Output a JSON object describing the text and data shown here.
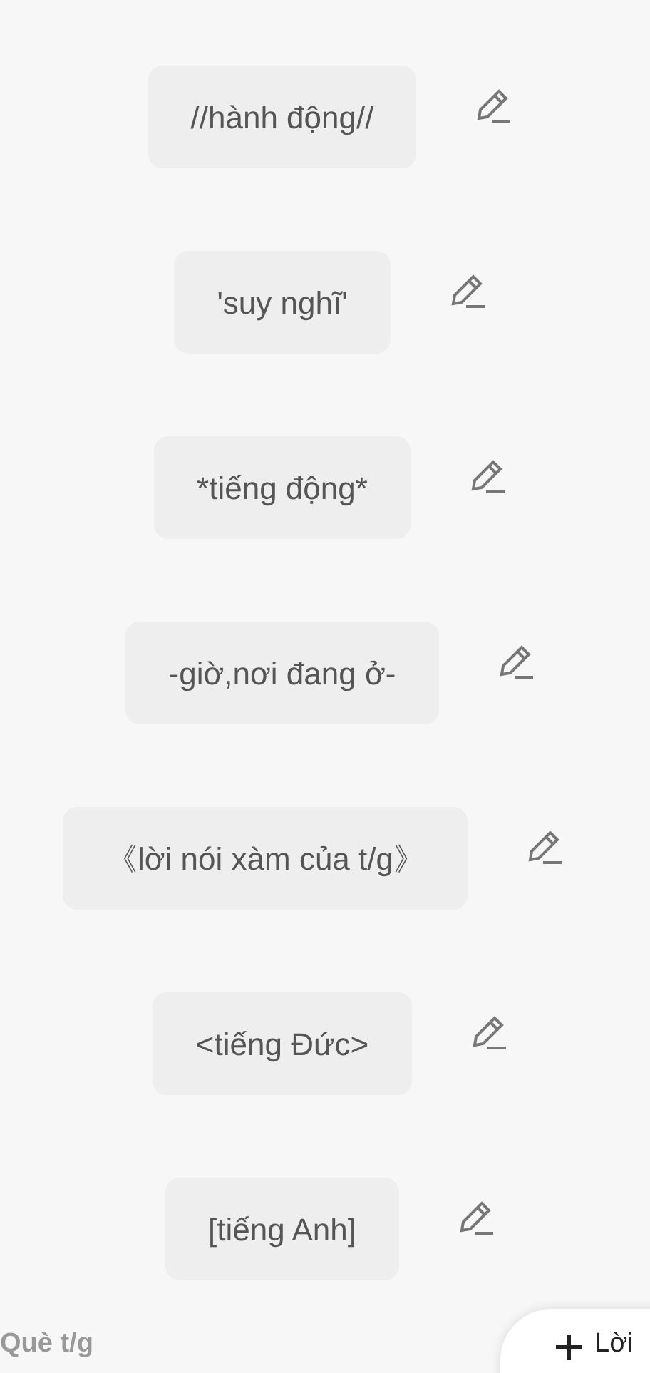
{
  "formats": [
    {
      "label": "//hành động//"
    },
    {
      "label": "'suy nghĩ'"
    },
    {
      "label": "*tiếng động*"
    },
    {
      "label": "-giờ,nơi đang ở-"
    },
    {
      "label": "《lời nói xàm của t/g》"
    },
    {
      "label": "<tiếng Đức>"
    },
    {
      "label": "[tiếng Anh]"
    }
  ],
  "footer": {
    "label": "Què t/g",
    "add_button": "Lời"
  }
}
